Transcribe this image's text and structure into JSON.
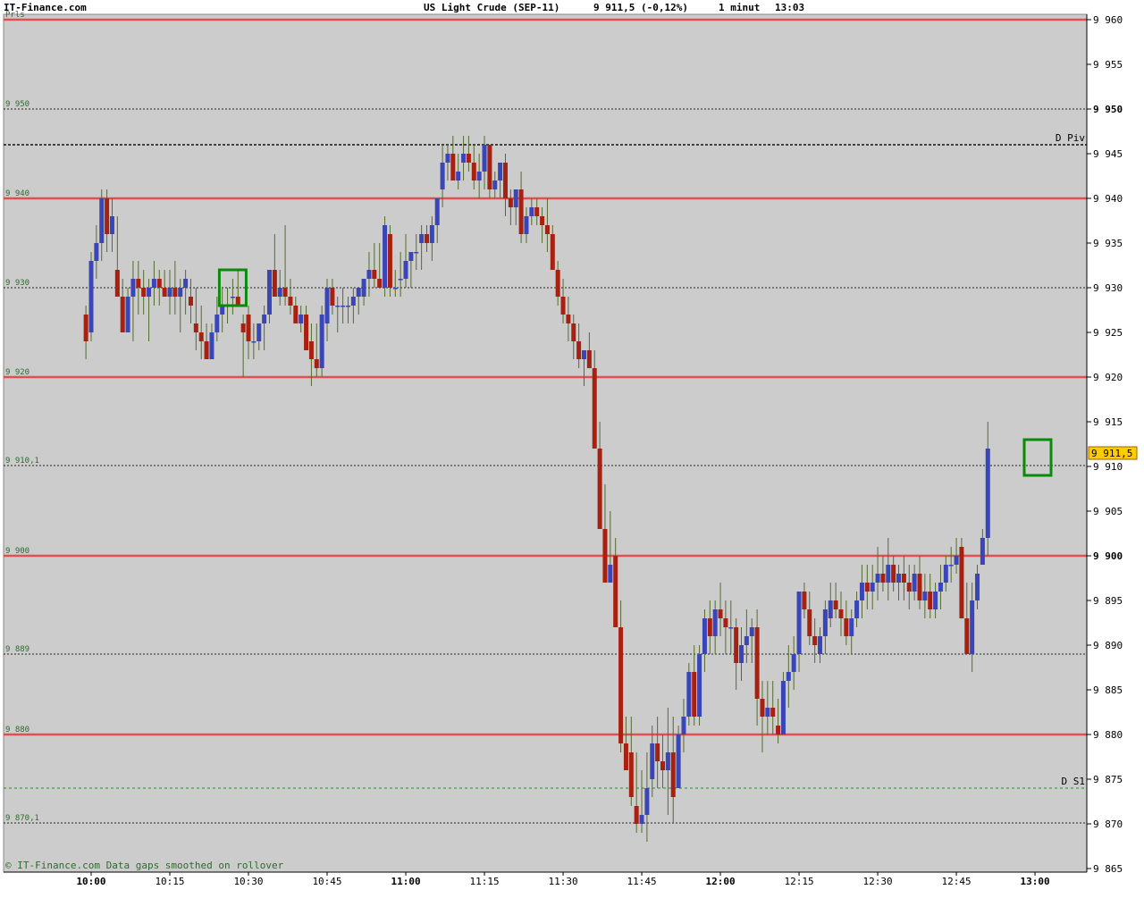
{
  "header": {
    "site": "IT-Finance.com",
    "instrument": "US Light Crude (SEP-11)",
    "quote": "9 911,5 (-0,12%)",
    "interval": "1 minut",
    "time": "13:03"
  },
  "footer_note": "© IT-Finance.com Data gaps smoothed on rollover",
  "colors": {
    "background": "#cccccc",
    "up": "#3a46b8",
    "down": "#a82010",
    "wick": "#556b2f",
    "level_line": "#e05050",
    "marker": "#0a8a0a",
    "price_tag": "#ffcc00"
  },
  "chart_data": {
    "type": "candlestick",
    "ylim": [
      9864,
      9961
    ],
    "y_ticks": [
      {
        "v": 9960,
        "label": "9 960",
        "bold": false
      },
      {
        "v": 9955,
        "label": "9 955",
        "bold": false
      },
      {
        "v": 9950,
        "label": "9 950",
        "bold": true
      },
      {
        "v": 9945,
        "label": "9 945",
        "bold": false
      },
      {
        "v": 9940,
        "label": "9 940",
        "bold": false
      },
      {
        "v": 9935,
        "label": "9 935",
        "bold": false
      },
      {
        "v": 9930,
        "label": "9 930",
        "bold": false
      },
      {
        "v": 9925,
        "label": "9 925",
        "bold": false
      },
      {
        "v": 9920,
        "label": "9 920",
        "bold": false
      },
      {
        "v": 9915,
        "label": "9 915",
        "bold": false
      },
      {
        "v": 9910,
        "label": "9 910",
        "bold": false
      },
      {
        "v": 9905,
        "label": "9 905",
        "bold": false
      },
      {
        "v": 9900,
        "label": "9 900",
        "bold": true
      },
      {
        "v": 9895,
        "label": "9 895",
        "bold": false
      },
      {
        "v": 9890,
        "label": "9 890",
        "bold": false
      },
      {
        "v": 9885,
        "label": "9 885",
        "bold": false
      },
      {
        "v": 9880,
        "label": "9 880",
        "bold": false
      },
      {
        "v": 9875,
        "label": "9 875",
        "bold": false
      },
      {
        "v": 9870,
        "label": "9 870",
        "bold": false
      },
      {
        "v": 9865,
        "label": "9 865",
        "bold": false
      }
    ],
    "x_ticks": [
      {
        "m": 600,
        "label": "10:00",
        "bold": true
      },
      {
        "m": 615,
        "label": "10:15",
        "bold": false
      },
      {
        "m": 630,
        "label": "10:30",
        "bold": false
      },
      {
        "m": 645,
        "label": "10:45",
        "bold": false
      },
      {
        "m": 660,
        "label": "11:00",
        "bold": true
      },
      {
        "m": 675,
        "label": "11:15",
        "bold": false
      },
      {
        "m": 690,
        "label": "11:30",
        "bold": false
      },
      {
        "m": 705,
        "label": "11:45",
        "bold": false
      },
      {
        "m": 720,
        "label": "12:00",
        "bold": true
      },
      {
        "m": 735,
        "label": "12:15",
        "bold": false
      },
      {
        "m": 750,
        "label": "12:30",
        "bold": false
      },
      {
        "m": 765,
        "label": "12:45",
        "bold": false
      },
      {
        "m": 780,
        "label": "13:00",
        "bold": true
      }
    ],
    "levels": [
      {
        "v": 9960,
        "style": "red",
        "label": "Prls"
      },
      {
        "v": 9950,
        "style": "dotted",
        "label": "9 950"
      },
      {
        "v": 9946,
        "style": "dashed",
        "label": "",
        "right_label": "D Piv"
      },
      {
        "v": 9940,
        "style": "red",
        "label": "9 940"
      },
      {
        "v": 9930,
        "style": "dotted",
        "label": "9 930"
      },
      {
        "v": 9920,
        "style": "red",
        "label": "9 920"
      },
      {
        "v": 9910.1,
        "style": "dotted",
        "label": "9 910,1"
      },
      {
        "v": 9900,
        "style": "red",
        "label": "9 900"
      },
      {
        "v": 9889,
        "style": "dotted",
        "label": "9 889"
      },
      {
        "v": 9880,
        "style": "red",
        "label": "9 880"
      },
      {
        "v": 9874,
        "style": "green-dashed",
        "label": "",
        "right_label": "D S1"
      },
      {
        "v": 9870.1,
        "style": "dotted",
        "label": "9 870,1"
      }
    ],
    "last_price": {
      "v": 9911.5,
      "label": "9 911,5"
    },
    "markers": [
      {
        "m": 627,
        "low": 9928,
        "high": 9932
      },
      {
        "m": 780.5,
        "low": 9909,
        "high": 9913
      }
    ],
    "candles_start": "09:59",
    "ohlc": [
      [
        9927,
        9928,
        9922,
        9924
      ],
      [
        9925,
        9934,
        9924,
        9933
      ],
      [
        9933,
        9937,
        9931,
        9935
      ],
      [
        9935,
        9941,
        9933,
        9940
      ],
      [
        9940,
        9941,
        9934,
        9936
      ],
      [
        9936,
        9940,
        9934,
        9938
      ],
      [
        9932,
        9938,
        9929,
        9929
      ],
      [
        9929,
        9931,
        9925,
        9925
      ],
      [
        9925,
        9930,
        9925,
        9929
      ],
      [
        9929,
        9933,
        9924,
        9931
      ],
      [
        9931,
        9933,
        9927,
        9930
      ],
      [
        9930,
        9932,
        9927,
        9929
      ],
      [
        9929,
        9931,
        9924,
        9930
      ],
      [
        9930,
        9933,
        9928,
        9931
      ],
      [
        9931,
        9932,
        9928,
        9930
      ],
      [
        9930,
        9932,
        9929,
        9929
      ],
      [
        9929,
        9932,
        9927,
        9930
      ],
      [
        9930,
        9933,
        9927,
        9929
      ],
      [
        9929,
        9931,
        9925,
        9930
      ],
      [
        9930,
        9932,
        9927,
        9931
      ],
      [
        9929,
        9931,
        9926,
        9928
      ],
      [
        9926,
        9930,
        9923,
        9925
      ],
      [
        9925,
        9928,
        9922,
        9924
      ],
      [
        9924,
        9926,
        9922,
        9922
      ],
      [
        9922,
        9926,
        9922,
        9925
      ],
      [
        9925,
        9929,
        9924,
        9927
      ],
      [
        9927,
        9930,
        9925,
        9928
      ],
      [
        9928,
        9930,
        9926,
        9928
      ],
      [
        9929,
        9931,
        9927,
        9929
      ],
      [
        9929,
        9932,
        9928,
        9928
      ],
      [
        9926,
        9927,
        9920,
        9925
      ],
      [
        9927,
        9928,
        9922,
        9924
      ],
      [
        9924,
        9926,
        9922,
        9924
      ],
      [
        9924,
        9926,
        9923,
        9926
      ],
      [
        9926,
        9928,
        9923,
        9927
      ],
      [
        9927,
        9932,
        9926,
        9932
      ],
      [
        9932,
        9936,
        9929,
        9929
      ],
      [
        9929,
        9932,
        9928,
        9930
      ],
      [
        9930,
        9937,
        9928,
        9929
      ],
      [
        9929,
        9931,
        9927,
        9928
      ],
      [
        9928,
        9929,
        9926,
        9926
      ],
      [
        9926,
        9928,
        9925,
        9927
      ],
      [
        9927,
        9928,
        9923,
        9923
      ],
      [
        9924,
        9926,
        9919,
        9922
      ],
      [
        9922,
        9926,
        9920,
        9921
      ],
      [
        9921,
        9928,
        9920,
        9927
      ],
      [
        9926,
        9931,
        9924,
        9930
      ],
      [
        9930,
        9931,
        9927,
        9928
      ],
      [
        9928,
        9929,
        9925,
        9928
      ],
      [
        9928,
        9930,
        9926,
        9928
      ],
      [
        9928,
        9929,
        9926,
        9928
      ],
      [
        9928,
        9930,
        9926,
        9929
      ],
      [
        9929,
        9930,
        9927,
        9930
      ],
      [
        9929,
        9931,
        9928,
        9931
      ],
      [
        9931,
        9934,
        9929,
        9932
      ],
      [
        9932,
        9935,
        9930,
        9931
      ],
      [
        9931,
        9935,
        9930,
        9930
      ],
      [
        9930,
        9938,
        9929,
        9937
      ],
      [
        9936,
        9937,
        9929,
        9930
      ],
      [
        9930,
        9932,
        9929,
        9930
      ],
      [
        9931,
        9934,
        9929,
        9931
      ],
      [
        9931,
        9936,
        9930,
        9933
      ],
      [
        9933,
        9934,
        9930,
        9934
      ],
      [
        9934,
        9936,
        9932,
        9934
      ],
      [
        9935,
        9937,
        9932,
        9936
      ],
      [
        9936,
        9937,
        9934,
        9935
      ],
      [
        9935,
        9938,
        9933,
        9937
      ],
      [
        9937,
        9940,
        9935,
        9940
      ],
      [
        9941,
        9946,
        9939,
        9944
      ],
      [
        9944,
        9946,
        9942,
        9945
      ],
      [
        9945,
        9947,
        9942,
        9942
      ],
      [
        9942,
        9945,
        9941,
        9943
      ],
      [
        9944,
        9947,
        9942,
        9945
      ],
      [
        9945,
        9947,
        9943,
        9944
      ],
      [
        9944,
        9946,
        9941,
        9942
      ],
      [
        9942,
        9945,
        9940,
        9943
      ],
      [
        9943,
        9947,
        9941,
        9946
      ],
      [
        9946,
        9945,
        9940,
        9941
      ],
      [
        9941,
        9943,
        9940,
        9942
      ],
      [
        9942,
        9944,
        9940,
        9944
      ],
      [
        9944,
        9945,
        9938,
        9940
      ],
      [
        9940,
        9941,
        9937,
        9939
      ],
      [
        9939,
        9941,
        9937,
        9941
      ],
      [
        9941,
        9943,
        9935,
        9936
      ],
      [
        9936,
        9939,
        9935,
        9938
      ],
      [
        9938,
        9940,
        9937,
        9939
      ],
      [
        9939,
        9940,
        9937,
        9938
      ],
      [
        9938,
        9939,
        9935,
        9937
      ],
      [
        9937,
        9940,
        9934,
        9936
      ],
      [
        9936,
        9937,
        9932,
        9932
      ],
      [
        9932,
        9933,
        9928,
        9929
      ],
      [
        9929,
        9931,
        9926,
        9927
      ],
      [
        9927,
        9929,
        9924,
        9926
      ],
      [
        9926,
        9927,
        9922,
        9924
      ],
      [
        9924,
        9926,
        9921,
        9922
      ],
      [
        9922,
        9923,
        9919,
        9923
      ],
      [
        9923,
        9925,
        9921,
        9921
      ],
      [
        9921,
        9923,
        9912,
        9912
      ],
      [
        9912,
        9915,
        9903,
        9903
      ],
      [
        9903,
        9908,
        9897,
        9897
      ],
      [
        9897,
        9905,
        9898,
        9899
      ],
      [
        9900,
        9902,
        9892,
        9892
      ],
      [
        9892,
        9895,
        9878,
        9879
      ],
      [
        9879,
        9882,
        9876,
        9876
      ],
      [
        9878,
        9882,
        9872,
        9873
      ],
      [
        9872,
        9878,
        9869,
        9870
      ],
      [
        9870,
        9876,
        9869,
        9871
      ],
      [
        9871,
        9878,
        9868,
        9874
      ],
      [
        9875,
        9881,
        9873,
        9879
      ],
      [
        9879,
        9882,
        9874,
        9877
      ],
      [
        9877,
        9880,
        9874,
        9876
      ],
      [
        9876,
        9883,
        9871,
        9878
      ],
      [
        9878,
        9882,
        9870,
        9873
      ],
      [
        9874,
        9881,
        9874,
        9880
      ],
      [
        9880,
        9884,
        9878,
        9882
      ],
      [
        9882,
        9888,
        9881,
        9887
      ],
      [
        9887,
        9890,
        9881,
        9882
      ],
      [
        9882,
        9890,
        9881,
        9889
      ],
      [
        9889,
        9894,
        9887,
        9893
      ],
      [
        9893,
        9895,
        9889,
        9891
      ],
      [
        9891,
        9895,
        9889,
        9894
      ],
      [
        9894,
        9897,
        9891,
        9893
      ],
      [
        9893,
        9895,
        9889,
        9892
      ],
      [
        9892,
        9895,
        9889,
        9892
      ],
      [
        9892,
        9893,
        9885,
        9888
      ],
      [
        9888,
        9892,
        9886,
        9890
      ],
      [
        9890,
        9894,
        9888,
        9891
      ],
      [
        9891,
        9893,
        9888,
        9892
      ],
      [
        9892,
        9894,
        9881,
        9884
      ],
      [
        9884,
        9886,
        9878,
        9882
      ],
      [
        9882,
        9886,
        9880,
        9883
      ],
      [
        9883,
        9886,
        9880,
        9882
      ],
      [
        9881,
        9884,
        9879,
        9880
      ],
      [
        9880,
        9887,
        9880,
        9886
      ],
      [
        9886,
        9890,
        9883,
        9887
      ],
      [
        9887,
        9891,
        9885,
        9889
      ],
      [
        9889,
        9896,
        9887,
        9896
      ],
      [
        9896,
        9897,
        9893,
        9894
      ],
      [
        9894,
        9896,
        9890,
        9891
      ],
      [
        9891,
        9893,
        9888,
        9890
      ],
      [
        9889,
        9892,
        9888,
        9891
      ],
      [
        9891,
        9895,
        9889,
        9894
      ],
      [
        9893,
        9897,
        9892,
        9895
      ],
      [
        9895,
        9897,
        9893,
        9894
      ],
      [
        9894,
        9896,
        9891,
        9893
      ],
      [
        9893,
        9895,
        9890,
        9891
      ],
      [
        9891,
        9894,
        9889,
        9893
      ],
      [
        9893,
        9896,
        9892,
        9895
      ],
      [
        9895,
        9899,
        9893,
        9897
      ],
      [
        9897,
        9899,
        9894,
        9896
      ],
      [
        9896,
        9899,
        9894,
        9897
      ],
      [
        9897,
        9901,
        9895,
        9898
      ],
      [
        9898,
        9900,
        9896,
        9897
      ],
      [
        9897,
        9902,
        9895,
        9899
      ],
      [
        9899,
        9900,
        9896,
        9897
      ],
      [
        9897,
        9899,
        9895,
        9898
      ],
      [
        9898,
        9900,
        9895,
        9897
      ],
      [
        9897,
        9899,
        9894,
        9896
      ],
      [
        9896,
        9899,
        9895,
        9898
      ],
      [
        9898,
        9900,
        9894,
        9895
      ],
      [
        9895,
        9898,
        9893,
        9896
      ],
      [
        9896,
        9898,
        9893,
        9894
      ],
      [
        9894,
        9897,
        9893,
        9896
      ],
      [
        9896,
        9899,
        9894,
        9897
      ],
      [
        9897,
        9900,
        9896,
        9899
      ],
      [
        9899,
        9901,
        9897,
        9899
      ],
      [
        9899,
        9902,
        9898,
        9900
      ],
      [
        9901,
        9902,
        9893,
        9893
      ],
      [
        9893,
        9897,
        9890,
        9889
      ],
      [
        9889,
        9897,
        9887,
        9895
      ],
      [
        9895,
        9899,
        9894,
        9898
      ],
      [
        9899,
        9903,
        9900,
        9902
      ],
      [
        9902,
        9915,
        9900,
        9912
      ]
    ]
  }
}
